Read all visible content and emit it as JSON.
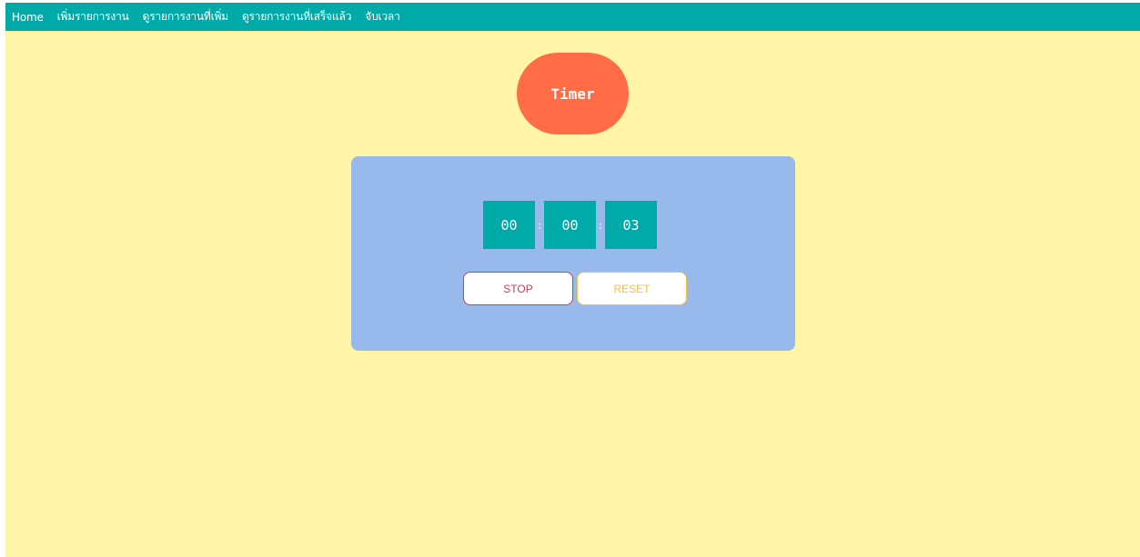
{
  "nav": {
    "links": [
      {
        "label": "Home"
      },
      {
        "label": "เพิ่มรายการงาน"
      },
      {
        "label": "ดูรายการงานที่เพิ่ม"
      },
      {
        "label": "ดูรายการงานที่เสร็จแล้ว"
      },
      {
        "label": "จับเวลา"
      }
    ]
  },
  "title": "Timer",
  "timer": {
    "hours": "00",
    "minutes": "00",
    "seconds": "03",
    "separator": ":"
  },
  "buttons": {
    "stop_label": "STOP",
    "reset_label": "RESET"
  },
  "colors": {
    "page_background": "#fff5a8",
    "navbar": "#00aaa8",
    "title_pill": "#ff6c46",
    "card": "#97b9ec",
    "digit_box": "#00aaa8",
    "stop": "#c0435a",
    "reset": "#f2c141"
  }
}
